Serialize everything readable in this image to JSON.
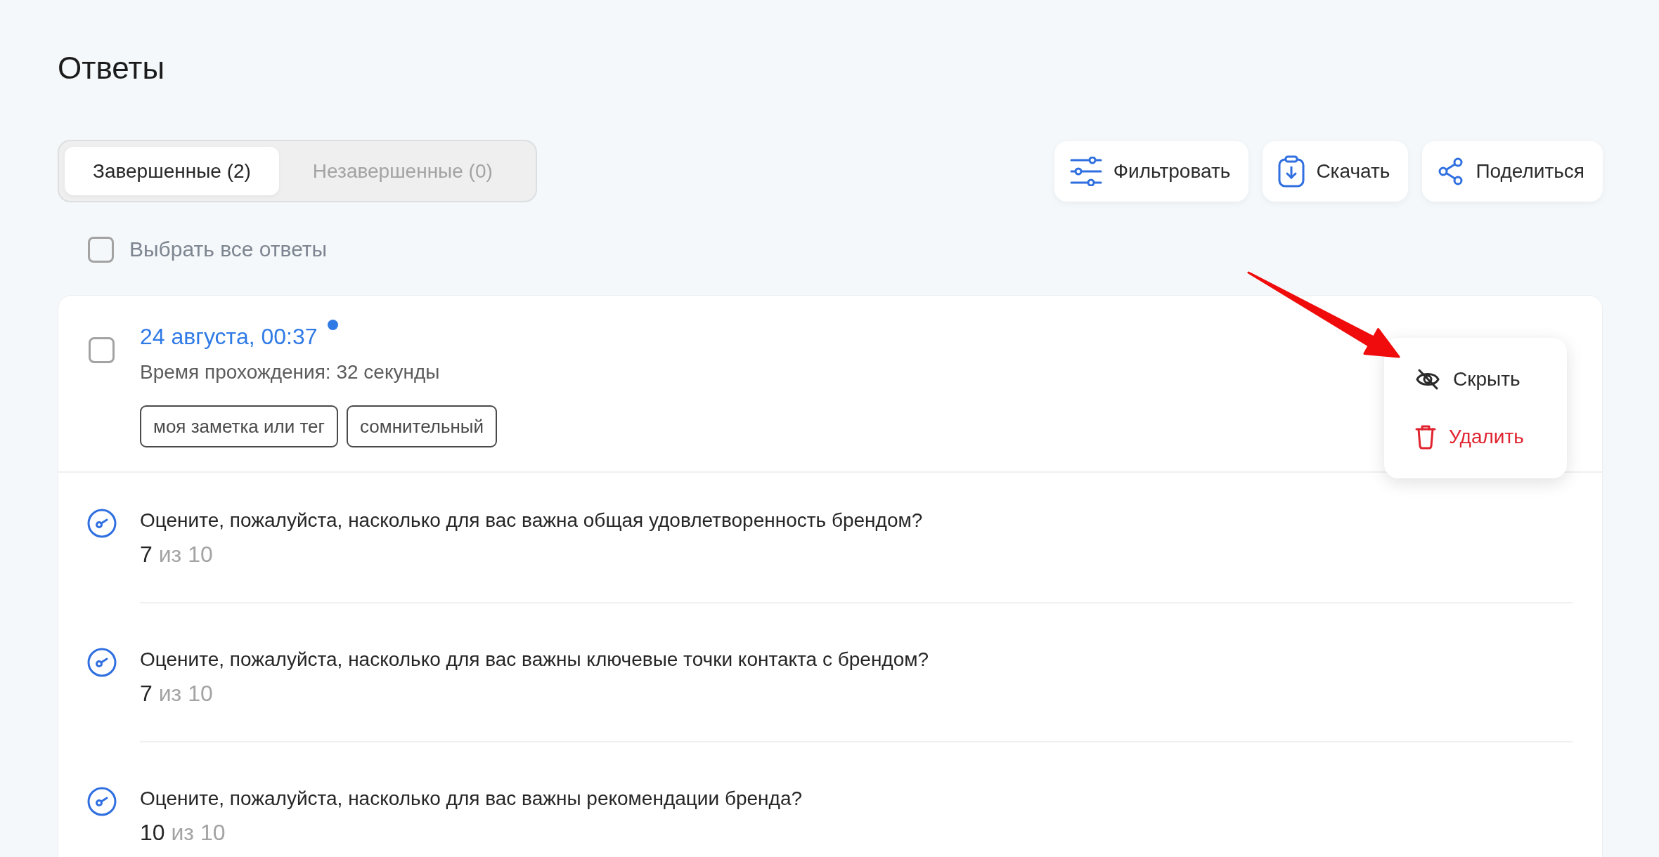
{
  "page": {
    "title": "Ответы"
  },
  "tabs": [
    {
      "label": "Завершенные (2)",
      "selected": true
    },
    {
      "label": "Незавершенные (0)",
      "selected": false
    }
  ],
  "actions": [
    {
      "kind": "filter",
      "label": "Фильтровать"
    },
    {
      "kind": "download",
      "label": "Скачать"
    },
    {
      "kind": "share",
      "label": "Поделиться"
    }
  ],
  "select_all": {
    "label": "Выбрать все ответы",
    "checked": false
  },
  "response": {
    "checked": false,
    "date": "24 августа, 00:37",
    "unread": true,
    "duration": "Время прохождения: 32 секунды",
    "tags": [
      "моя заметка или тег",
      "сомнительный"
    ],
    "menu": [
      {
        "kind": "hide",
        "label": "Скрыть"
      },
      {
        "kind": "delete",
        "label": "Удалить"
      }
    ],
    "answers": [
      {
        "question": "Оцените, пожалуйста, насколько для вас важна общая удовлетворенность брендом?",
        "value": "7",
        "scale": "из 10"
      },
      {
        "question": "Оцените, пожалуйста, насколько для вас важны ключевые точки контакта с брендом?",
        "value": "7",
        "scale": "из 10"
      },
      {
        "question": "Оцените, пожалуйста, насколько для вас важны рекомендации бренда?",
        "value": "10",
        "scale": "из 10"
      }
    ]
  }
}
